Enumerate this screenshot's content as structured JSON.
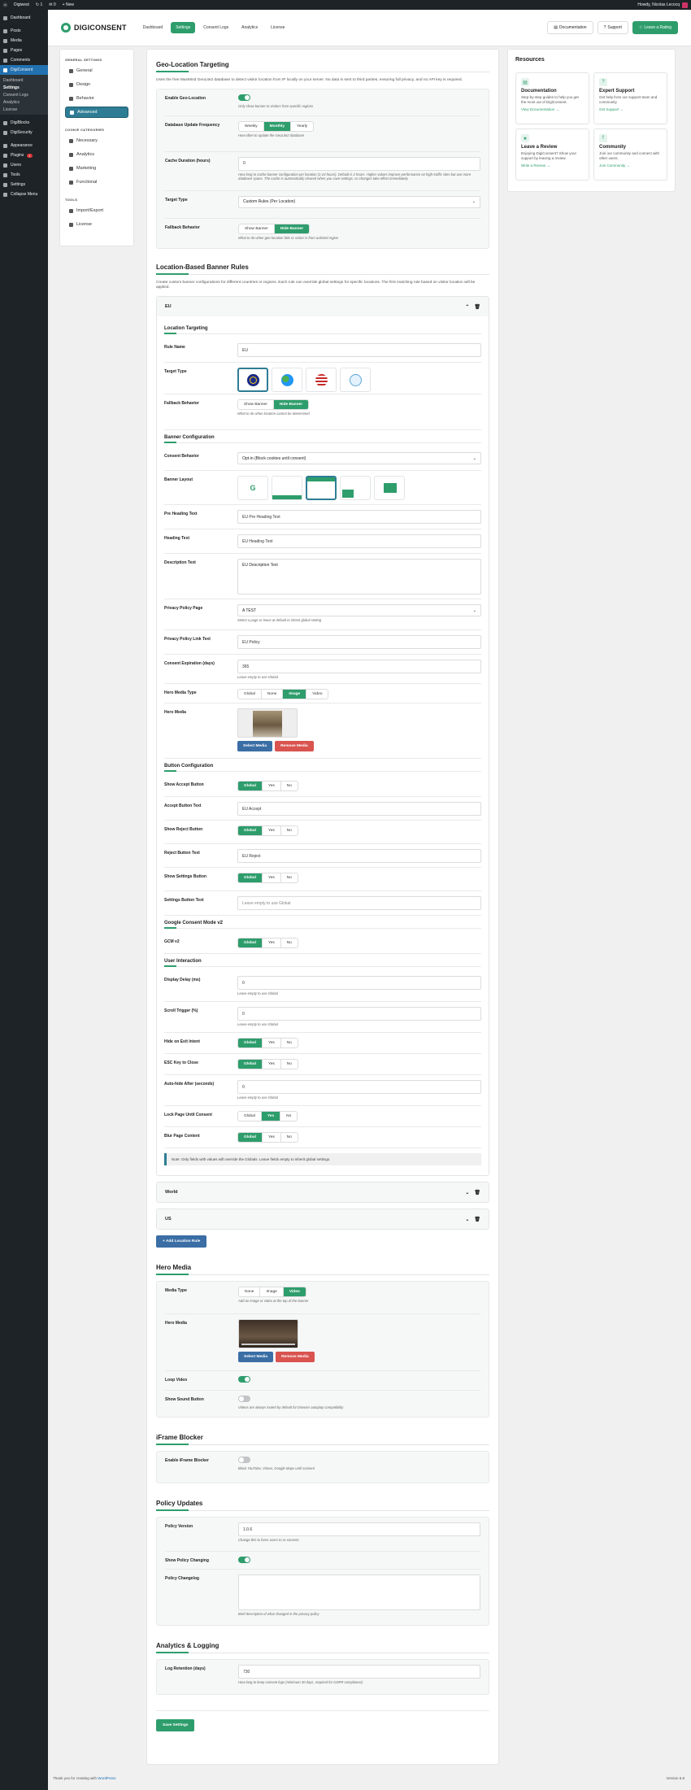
{
  "adminbar": {
    "site": "Digiwest",
    "updates": "1",
    "comments": "0",
    "new": "New",
    "howdy": "Howdy, Nicolas Lecocq"
  },
  "wpmenu": {
    "items": [
      "Dashboard",
      "Posts",
      "Media",
      "Pages",
      "Comments",
      "DigiConsent"
    ],
    "sub": [
      "Dashboard",
      "Settings",
      "Consent Logs",
      "Analytics",
      "License"
    ],
    "items2": [
      "DigiBlocks",
      "DigiSecurity",
      "Appearance",
      "Plugins",
      "Users",
      "Tools",
      "Settings",
      "Collapse Menu"
    ],
    "plugins_badge": "1"
  },
  "nav": {
    "brand": "DIGICONSENT",
    "tabs": [
      "Dashboard",
      "Settings",
      "Consent Logs",
      "Analytics",
      "License"
    ],
    "documentation": "Documentation",
    "support": "Support",
    "rating": "Leave a Rating"
  },
  "sidebar": {
    "general_heading": "GENERAL SETTINGS",
    "general": [
      "General",
      "Design",
      "Behavior",
      "Advanced"
    ],
    "cookie_heading": "COOKIE CATEGORIES",
    "cookies": [
      "Necessary",
      "Analytics",
      "Marketing",
      "Functional"
    ],
    "tools_heading": "TOOLS",
    "tools": [
      "Import/Export",
      "License"
    ]
  },
  "geo": {
    "title": "Geo-Location Targeting",
    "desc": "Uses the free MaxMind GeoLite2 database to detect visitor location from IP locally on your server. No data is sent to third parties, ensuring full privacy, and no API key is required.",
    "enable_label": "Enable Geo-Location",
    "enable_help": "Only show banner to visitors from specific regions",
    "db_label": "Database Update Frequency",
    "db_opts": [
      "Weekly",
      "Monthly",
      "Yearly"
    ],
    "db_help": "How often to update the GeoLite2 database",
    "cache_label": "Cache Duration (hours)",
    "cache_value": "0",
    "cache_help": "How long to cache banner configuration per location (1-24 hours). Default is 2 hours. Higher values improve performance on high-traffic sites but use more database space. The cache is automatically cleared when you save settings, so changes take effect immediately.",
    "target_label": "Target Type",
    "target_value": "Custom Rules (Per Location)",
    "fallback_label": "Fallback Behavior",
    "fallback_opts": [
      "Show Banner",
      "Hide Banner"
    ],
    "fallback_help": "What to do when geo-location fails or visitor is from unlisted region"
  },
  "rules": {
    "title": "Location-Based Banner Rules",
    "desc": "Create custom banner configurations for different countries or regions. Each rule can override global settings for specific locations. The first matching rule based on visitor location will be applied.",
    "eu": {
      "name": "EU",
      "targeting_heading": "Location Targeting",
      "rule_name_label": "Rule Name",
      "rule_name": "EU",
      "target_type_label": "Target Type",
      "fallback_label": "Fallback Behavior",
      "fallback_opts": [
        "Show Banner",
        "Hide Banner"
      ],
      "fallback_help": "What to do when location cannot be determined",
      "banner_heading": "Banner Configuration",
      "consent_label": "Consent Behavior",
      "consent_value": "Opt-in (Block cookies until consent)",
      "layout_label": "Banner Layout",
      "layout_g": "G",
      "pre_heading_label": "Pre Heading Text",
      "pre_heading": "EU Pre Heading Text",
      "heading_label": "Heading Text",
      "heading": "EU Heading Text",
      "description_label": "Description Text",
      "description": "EU Description Text",
      "privacy_label": "Privacy Policy Page",
      "privacy_value": "A TEST",
      "privacy_help": "Select a page or leave at default to inherit global setting",
      "privacy_link_label": "Privacy Policy Link Text",
      "privacy_link": "EU Policy",
      "expiration_label": "Consent Expiration (days)",
      "expiration": "365",
      "expiration_help": "Leave empty to use Global",
      "hero_type_label": "Hero Media Type",
      "hero_type_opts": [
        "Global",
        "None",
        "Image",
        "Video"
      ],
      "hero_media_label": "Hero Media",
      "select_media": "Select Media",
      "remove_media": "Remove Media",
      "button_heading": "Button Configuration",
      "gny": [
        "Global",
        "Yes",
        "No"
      ],
      "show_accept_label": "Show Accept Button",
      "accept_text_label": "Accept Button Text",
      "accept_text": "EU Accept",
      "show_reject_label": "Show Reject Button",
      "reject_text_label": "Reject Button Text",
      "reject_text": "EU Reject",
      "show_settings_label": "Show Settings Button",
      "settings_text_label": "Settings Button Text",
      "settings_text_ph": "Leave empty to use Global",
      "gcm_heading": "Google Consent Mode v2",
      "gcm_label": "GCM v2",
      "ui_heading": "User Interaction",
      "display_delay_label": "Display Delay (ms)",
      "display_delay": "0",
      "display_delay_help": "Leave empty to use Global",
      "scroll_label": "Scroll Trigger (%)",
      "scroll": "0",
      "scroll_help": "Leave empty to use Global",
      "exit_label": "Hide on Exit Intent",
      "esc_label": "ESC Key to Close",
      "autohide_label": "Auto-hide After (seconds)",
      "autohide": "0",
      "autohide_help": "Leave empty to use Global",
      "lock_label": "Lock Page Until Consent",
      "blur_label": "Blur Page Content",
      "note": "Note: Only fields with values will override the Globals. Leave fields empty to inherit global settings."
    },
    "world": "World",
    "us": "US",
    "add": "+ Add Location Rule"
  },
  "hero": {
    "title": "Hero Media",
    "type_label": "Media Type",
    "type_opts": [
      "None",
      "Image",
      "Video"
    ],
    "type_help": "Add an image or video at the top of the banner",
    "media_label": "Hero Media",
    "select_media": "Select Media",
    "remove_media": "Remove Media",
    "loop_label": "Loop Video",
    "sound_label": "Show Sound Button",
    "sound_help": "Videos are always muted by default for browser autoplay compatibility"
  },
  "iframe": {
    "title": "iFrame Blocker",
    "label": "Enable iFrame Blocker",
    "help": "Block YouTube, Vimeo, Google Maps until consent"
  },
  "policy": {
    "title": "Policy Updates",
    "version_label": "Policy Version",
    "version": "1.0.6",
    "version_help": "Change this to force users to re-consent",
    "changing_label": "Show Policy Changing",
    "changes_label": "Policy Changelog",
    "changes_help": "Brief description of what changed in the privacy policy"
  },
  "analytics": {
    "title": "Analytics & Logging",
    "retention_label": "Log Retention (days)",
    "retention": "730",
    "retention_help": "How long to keep consent logs (minimum 30 days, required for GDPR compliance)"
  },
  "save": "Save Settings",
  "resources": {
    "title": "Resources",
    "cards": [
      {
        "icon": "▤",
        "title": "Documentation",
        "desc": "Step-by-step guides to help you get the most out of DigiConsent.",
        "link": "View Documentation →"
      },
      {
        "icon": "?",
        "title": "Expert Support",
        "desc": "Get help from our support team and community.",
        "link": "Get Support →"
      },
      {
        "icon": "★",
        "title": "Leave a Review",
        "desc": "Enjoying DigiConsent? Show your support by leaving a review.",
        "link": "Write a Review →"
      },
      {
        "icon": "f",
        "title": "Community",
        "desc": "Join our community and connect with other users.",
        "link": "Join Community →"
      }
    ]
  },
  "footer": {
    "text": "Thank you for creating with",
    "link": "WordPress",
    "version": "Version 6.8"
  },
  "colors": {
    "accent": "#2e9d6c",
    "teal": "#2e7d94",
    "wpblue": "#2271b1",
    "danger": "#d9534f"
  }
}
